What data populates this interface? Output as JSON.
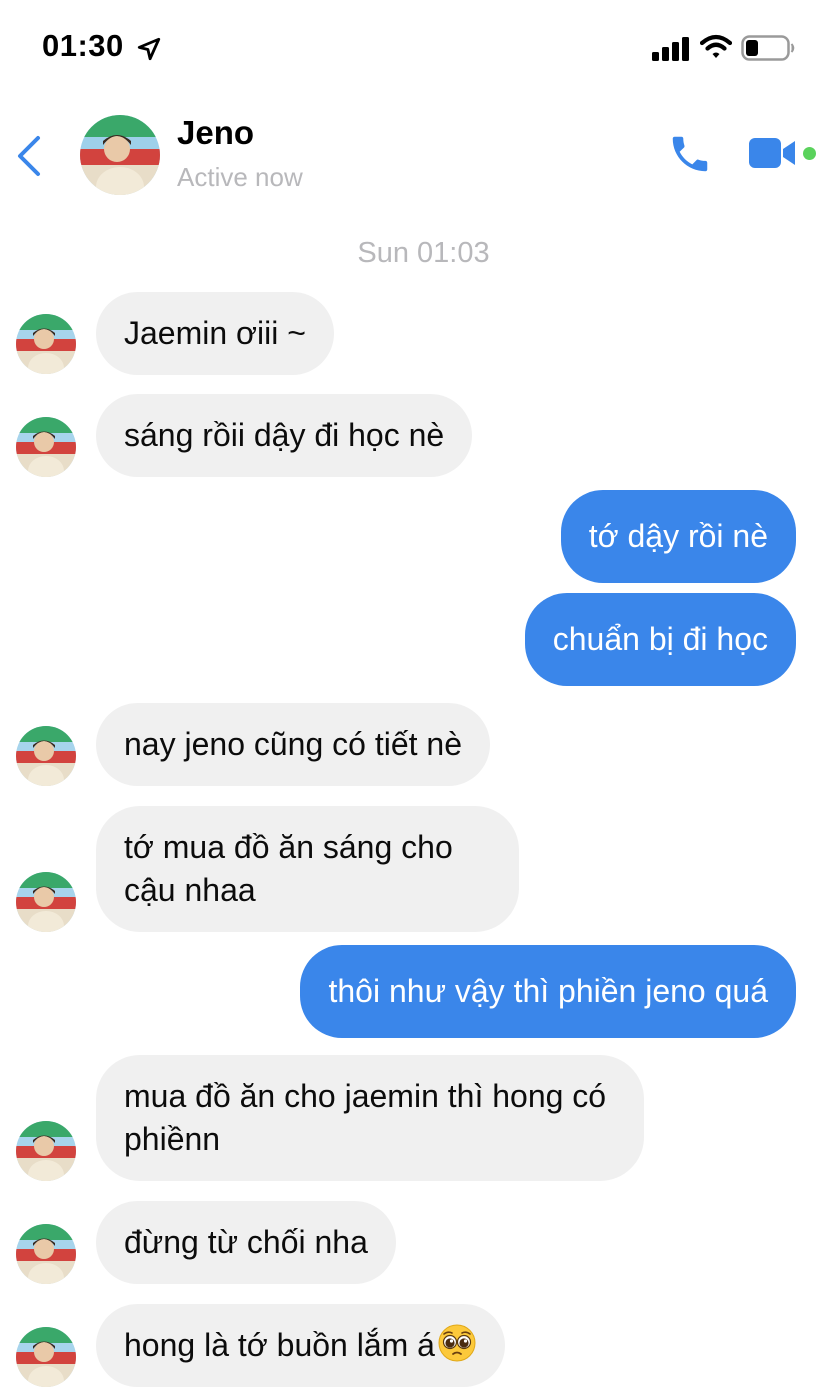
{
  "status_bar": {
    "time": "01:30"
  },
  "header": {
    "contact_name": "Jeno",
    "presence": "Active now",
    "accent_color": "#3a86ea"
  },
  "conversation": {
    "day_separator": "Sun 01:03",
    "messages": [
      {
        "from": "Jeno",
        "text": "Jaemin ơiii ~"
      },
      {
        "from": "Jeno",
        "text": "sáng rồii dậy đi học nè"
      },
      {
        "from": "me",
        "text": "tớ dậy rồi nè"
      },
      {
        "from": "me",
        "text": "chuẩn bị đi học"
      },
      {
        "from": "Jeno",
        "text": "nay jeno cũng có tiết nè"
      },
      {
        "from": "Jeno",
        "text": "tớ mua đồ ăn sáng cho cậu nhaa"
      },
      {
        "from": "me",
        "text": "thôi như vậy thì phiền jeno quá"
      },
      {
        "from": "Jeno",
        "text": "mua đồ ăn cho jaemin thì hong có phiềnn"
      },
      {
        "from": "Jeno",
        "text": "đừng từ chối nha"
      },
      {
        "from": "Jeno",
        "text": "hong là tớ buồn lắm á",
        "emoji": "pleading-face-emoji"
      }
    ]
  }
}
